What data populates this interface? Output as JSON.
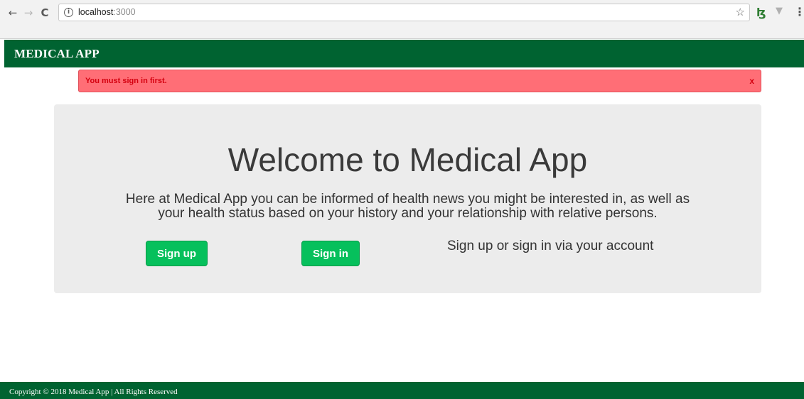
{
  "browser": {
    "back_icon": "←",
    "forward_icon": "→",
    "reload_icon": "C",
    "info_icon": "i",
    "url_host": "localhost",
    "url_port": ":3000",
    "bookmark_icon": "☆",
    "extension_b_icon": "ɮ",
    "extension_v_icon": "▼",
    "menu_icon": "⋮"
  },
  "header": {
    "brand": "MEDICAL APP",
    "background_color": "#006331"
  },
  "alert": {
    "message": "You must sign in first.",
    "close_label": "x",
    "background_color": "#ff6e76",
    "text_color": "#d4000f"
  },
  "hero": {
    "title": "Welcome to Medical App",
    "description_line1": "Here at Medical App you can be informed of health news you might be interested in, as well as",
    "description_line2": "your health status based on your history and your relationship with relative persons.",
    "signup_label": "Sign up",
    "signin_label": "Sign in",
    "cta_text": "Sign up or sign in via your account",
    "button_color": "#06c05c"
  },
  "footer": {
    "copyright": "Copyright © 2018 Medical App | All Rights Reserved"
  }
}
